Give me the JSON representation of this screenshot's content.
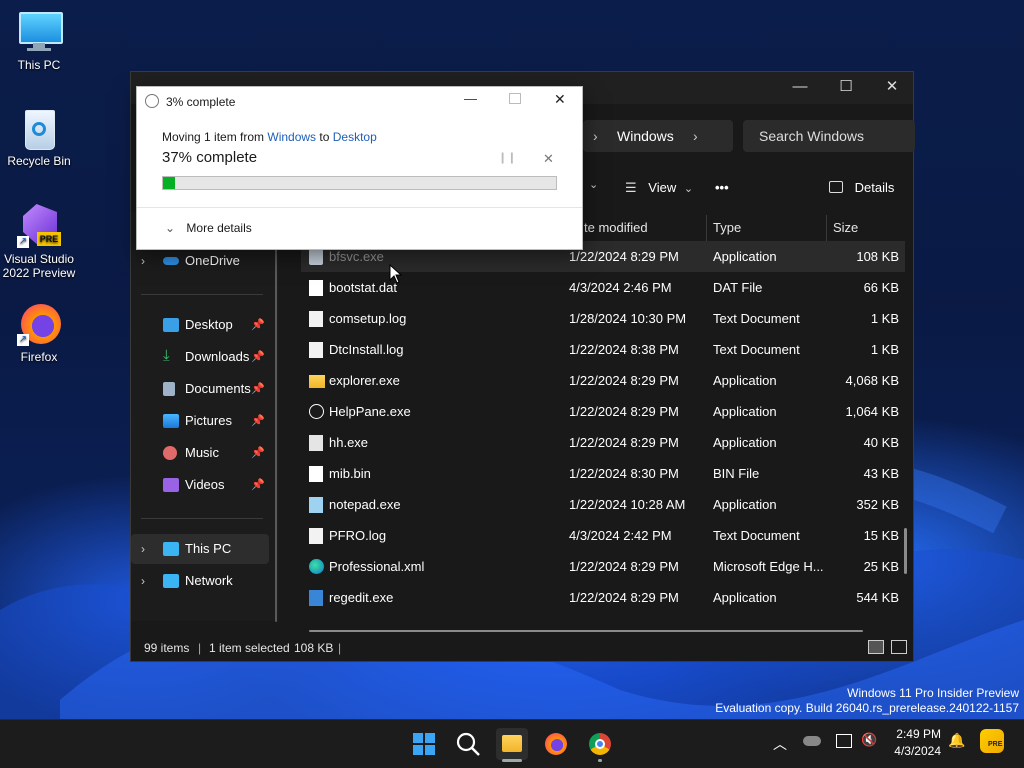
{
  "desktop": {
    "icons": [
      {
        "label": "This PC"
      },
      {
        "label": "Recycle Bin"
      },
      {
        "label": "Visual Studio 2022 Preview"
      },
      {
        "label": "Firefox"
      }
    ]
  },
  "explorer": {
    "breadcrumb_last": "Windows",
    "search_placeholder": "Search Windows",
    "toolbar": {
      "view_label": "View",
      "more_label": "•••",
      "details_label": "Details"
    },
    "columns": {
      "date": "te modified",
      "type": "Type",
      "size": "Size"
    },
    "nav": {
      "onedrive": "OneDrive",
      "quick": [
        {
          "label": "Desktop"
        },
        {
          "label": "Downloads"
        },
        {
          "label": "Documents"
        },
        {
          "label": "Pictures"
        },
        {
          "label": "Music"
        },
        {
          "label": "Videos"
        }
      ],
      "this_pc": "This PC",
      "network": "Network"
    },
    "files": [
      {
        "name": "bfsvc.exe",
        "date": "1/22/2024 8:29 PM",
        "type": "Application",
        "size": "108 KB",
        "icon": "app-icon"
      },
      {
        "name": "bootstat.dat",
        "date": "4/3/2024 2:46 PM",
        "type": "DAT File",
        "size": "66 KB",
        "icon": "file-icon"
      },
      {
        "name": "comsetup.log",
        "date": "1/28/2024 10:30 PM",
        "type": "Text Document",
        "size": "1 KB",
        "icon": "text-file-icon"
      },
      {
        "name": "DtcInstall.log",
        "date": "1/22/2024 8:38 PM",
        "type": "Text Document",
        "size": "1 KB",
        "icon": "text-file-icon"
      },
      {
        "name": "explorer.exe",
        "date": "1/22/2024 8:29 PM",
        "type": "Application",
        "size": "4,068 KB",
        "icon": "folder-app-icon"
      },
      {
        "name": "HelpPane.exe",
        "date": "1/22/2024 8:29 PM",
        "type": "Application",
        "size": "1,064 KB",
        "icon": "help-icon"
      },
      {
        "name": "hh.exe",
        "date": "1/22/2024 8:29 PM",
        "type": "Application",
        "size": "40 KB",
        "icon": "hh-icon"
      },
      {
        "name": "mib.bin",
        "date": "1/22/2024 8:30 PM",
        "type": "BIN File",
        "size": "43 KB",
        "icon": "file-icon"
      },
      {
        "name": "notepad.exe",
        "date": "1/22/2024 10:28 AM",
        "type": "Application",
        "size": "352 KB",
        "icon": "notepad-icon"
      },
      {
        "name": "PFRO.log",
        "date": "4/3/2024 2:42 PM",
        "type": "Text Document",
        "size": "15 KB",
        "icon": "text-file-icon"
      },
      {
        "name": "Professional.xml",
        "date": "1/22/2024 8:29 PM",
        "type": "Microsoft Edge H...",
        "size": "25 KB",
        "icon": "edge-icon"
      },
      {
        "name": "regedit.exe",
        "date": "1/22/2024 8:29 PM",
        "type": "Application",
        "size": "544 KB",
        "icon": "regedit-icon"
      }
    ],
    "status": {
      "items": "99 items",
      "selected": "1 item selected",
      "size": "108 KB"
    }
  },
  "dialog": {
    "title": "3% complete",
    "moving_prefix": "Moving 1 item from ",
    "source": "Windows",
    "to_word": " to ",
    "dest": "Desktop",
    "percent_text": "37% complete",
    "progress": 0.03,
    "more_details": "More details",
    "accent": "#06b025"
  },
  "watermark": {
    "line1": "Windows 11 Pro Insider Preview",
    "line2": "Evaluation copy. Build 26040.rs_prerelease.240122-1157"
  },
  "clock": {
    "time": "2:49 PM",
    "date": "4/3/2024"
  }
}
